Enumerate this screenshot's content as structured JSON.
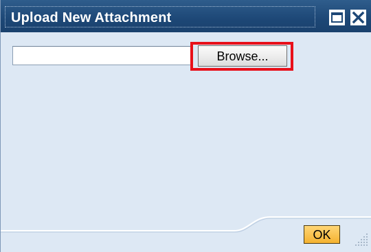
{
  "dialog": {
    "title": "Upload New Attachment",
    "maximize_icon": "maximize-icon",
    "close_icon": "close-icon"
  },
  "file_input": {
    "value": "",
    "placeholder": ""
  },
  "browse_button": {
    "label": "Browse..."
  },
  "ok_button": {
    "label": "OK"
  },
  "colors": {
    "titlebar": "#1d4776",
    "body": "#dde8f4",
    "highlight": "#e8101a",
    "ok_button": "#f4b230"
  }
}
